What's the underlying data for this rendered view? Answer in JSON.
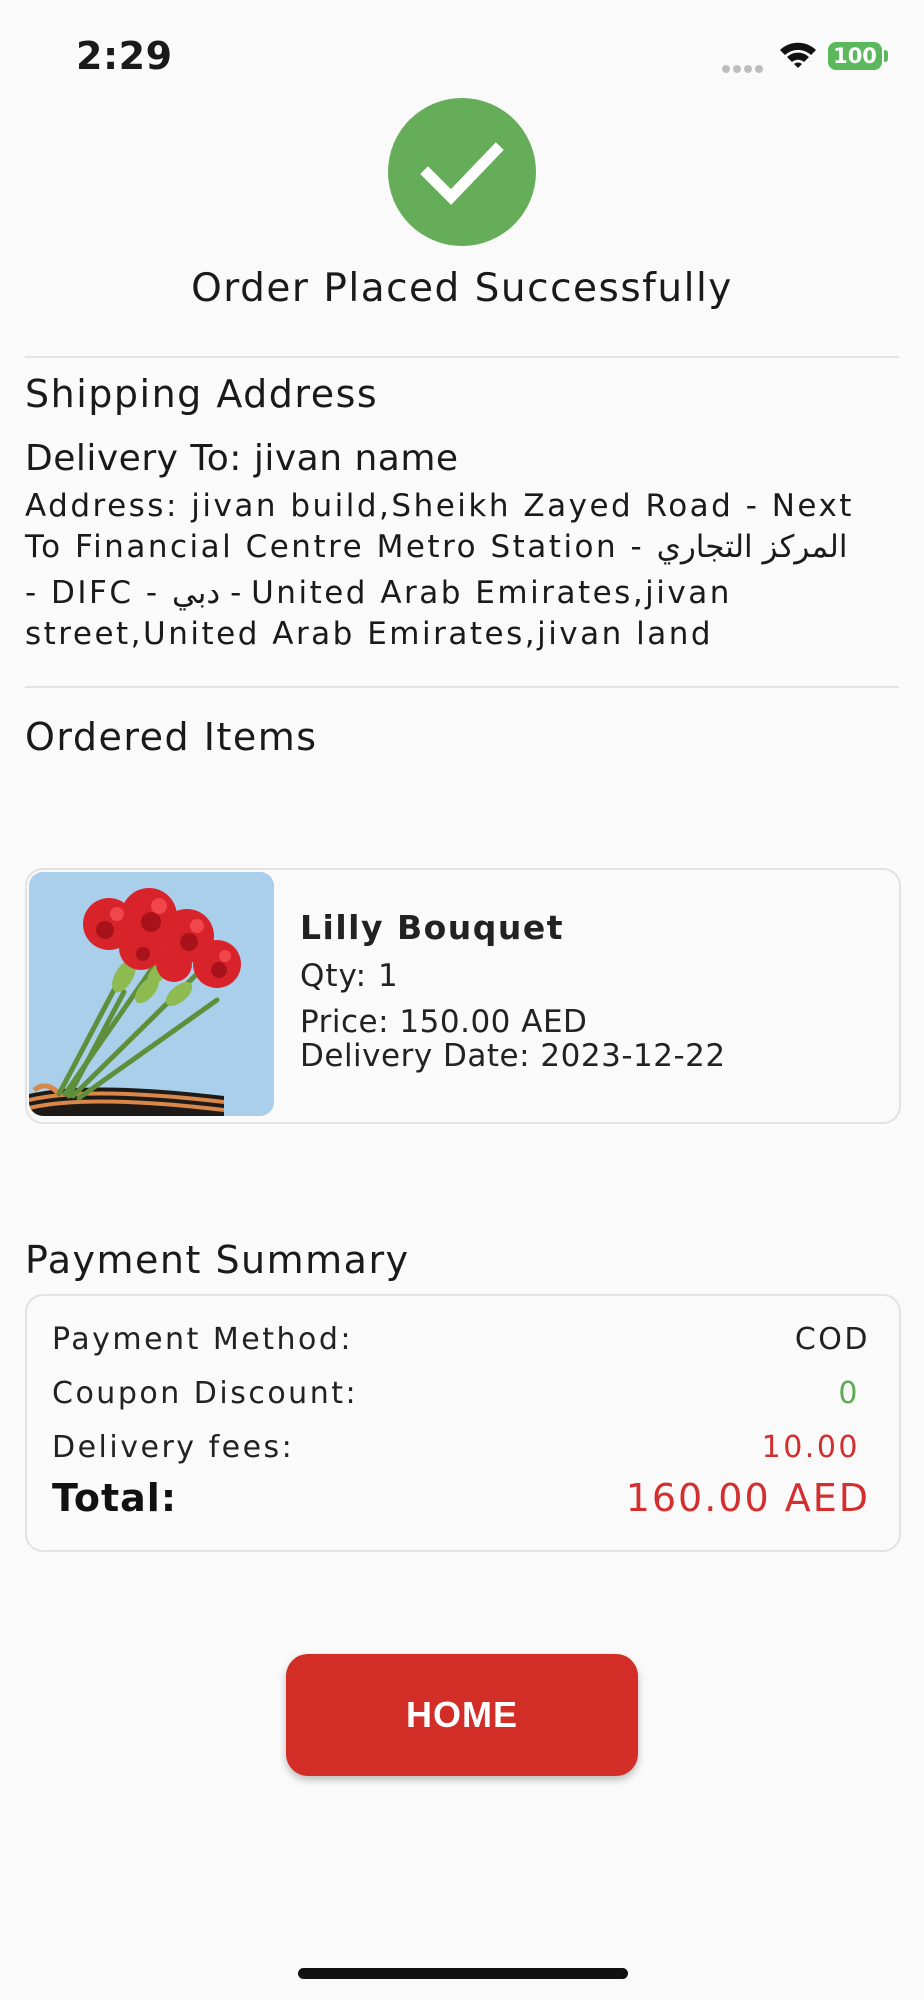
{
  "status_bar": {
    "time": "2:29",
    "battery": "100",
    "icons": [
      "signal-dots-icon",
      "wifi-icon",
      "battery-icon"
    ]
  },
  "success": {
    "icon": "checkmark-icon",
    "title": "Order Placed Successfully",
    "accent": "#66ad5a"
  },
  "shipping": {
    "section_title": "Shipping Address",
    "delivery_to": "Delivery To: jivan name",
    "address_lines": [
      "Address: jivan build,Sheikh Zayed Road - Next",
      "To Financial Centre Metro Station - المركز التجاري",
      "- DIFC - دبي - United Arab Emirates,jivan",
      "street,United Arab Emirates,jivan land"
    ]
  },
  "ordered_items": {
    "section_title": "Ordered Items",
    "items": [
      {
        "image": "red-carnation-bouquet-photo",
        "name": "Lilly Bouquet",
        "qty": "Qty: 1",
        "price": "Price: 150.00 AED",
        "delivery_date": "Delivery Date: 2023-12-22"
      }
    ]
  },
  "payment": {
    "section_title": "Payment Summary",
    "method_label": "Payment Method:",
    "method_value": "COD",
    "coupon_label": "Coupon Discount:",
    "coupon_value": "0",
    "delivery_label": "Delivery fees:",
    "delivery_value": "10.00",
    "total_label": "Total:",
    "total_value": "160.00 AED",
    "colors": {
      "discount": "#5cab53",
      "fee": "#d32f2f",
      "total": "#d32f2f"
    }
  },
  "actions": {
    "home_label": "HOME",
    "button_color": "#d22d26"
  }
}
